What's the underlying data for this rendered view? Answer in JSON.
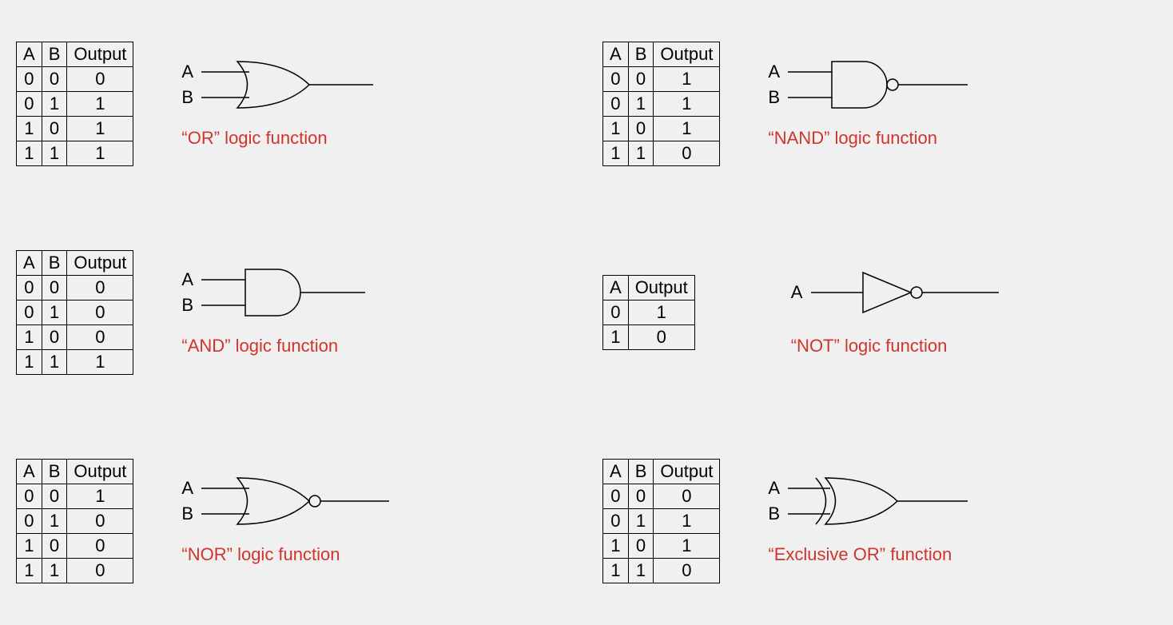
{
  "gates": {
    "or": {
      "headers": [
        "A",
        "B",
        "Output"
      ],
      "rows": [
        [
          "0",
          "0",
          "0"
        ],
        [
          "0",
          "1",
          "1"
        ],
        [
          "1",
          "0",
          "1"
        ],
        [
          "1",
          "1",
          "1"
        ]
      ],
      "inputs": [
        "A",
        "B"
      ],
      "caption": "“OR” logic function"
    },
    "nand": {
      "headers": [
        "A",
        "B",
        "Output"
      ],
      "rows": [
        [
          "0",
          "0",
          "1"
        ],
        [
          "0",
          "1",
          "1"
        ],
        [
          "1",
          "0",
          "1"
        ],
        [
          "1",
          "1",
          "0"
        ]
      ],
      "inputs": [
        "A",
        "B"
      ],
      "caption": "“NAND” logic function"
    },
    "and": {
      "headers": [
        "A",
        "B",
        "Output"
      ],
      "rows": [
        [
          "0",
          "0",
          "0"
        ],
        [
          "0",
          "1",
          "0"
        ],
        [
          "1",
          "0",
          "0"
        ],
        [
          "1",
          "1",
          "1"
        ]
      ],
      "inputs": [
        "A",
        "B"
      ],
      "caption": "“AND” logic function"
    },
    "not": {
      "headers": [
        "A",
        "Output"
      ],
      "rows": [
        [
          "0",
          "1"
        ],
        [
          "1",
          "0"
        ]
      ],
      "inputs": [
        "A"
      ],
      "caption": "“NOT” logic function"
    },
    "nor": {
      "headers": [
        "A",
        "B",
        "Output"
      ],
      "rows": [
        [
          "0",
          "0",
          "1"
        ],
        [
          "0",
          "1",
          "0"
        ],
        [
          "1",
          "0",
          "0"
        ],
        [
          "1",
          "1",
          "0"
        ]
      ],
      "inputs": [
        "A",
        "B"
      ],
      "caption": "“NOR” logic function"
    },
    "xor": {
      "headers": [
        "A",
        "B",
        "Output"
      ],
      "rows": [
        [
          "0",
          "0",
          "0"
        ],
        [
          "0",
          "1",
          "1"
        ],
        [
          "1",
          "0",
          "1"
        ],
        [
          "1",
          "1",
          "0"
        ]
      ],
      "inputs": [
        "A",
        "B"
      ],
      "caption": "“Exclusive OR” function"
    }
  }
}
